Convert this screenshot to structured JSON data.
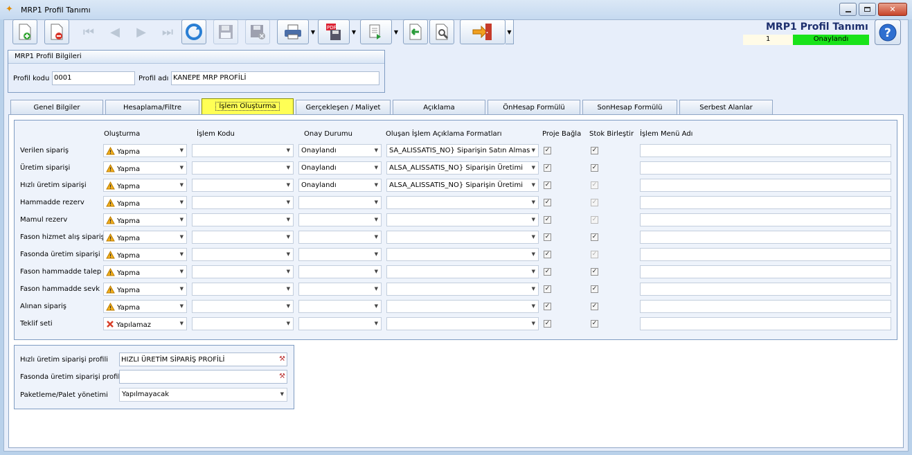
{
  "window": {
    "title": "MRP1 Profil Tanımı"
  },
  "header": {
    "title": "MRP1 Profil Tanımı",
    "record_no": "1",
    "status": "Onaylandı",
    "status_color": "#19e319"
  },
  "toolbar": {
    "icons": [
      "new-doc-icon",
      "delete-doc-icon",
      "first-record-icon",
      "prev-record-icon",
      "next-record-icon",
      "last-record-icon",
      "refresh-icon",
      "save-icon",
      "save-close-icon",
      "print-icon",
      "pdf-export-icon",
      "export-icon",
      "import-icon",
      "settings-icon",
      "exit-icon"
    ]
  },
  "profile_info": {
    "header": "MRP1 Profil Bilgileri",
    "code_label": "Profil kodu",
    "code_value": "0001",
    "name_label": "Profil adı",
    "name_value": "KANEPE MRP PROFİLİ"
  },
  "tabs": [
    "Genel Bilgiler",
    "Hesaplama/Filtre",
    "İşlem Oluşturma",
    "Gerçekleşen / Maliyet",
    "Açıklama",
    "ÖnHesap Formülü",
    "SonHesap Formülü",
    "Serbest Alanlar"
  ],
  "active_tab": "İşlem Oluşturma",
  "grid": {
    "columns": {
      "olusturma": "Oluşturma",
      "islem_kodu": "İşlem Kodu",
      "onay": "Onay Durumu",
      "aciklama": "Oluşan İşlem Açıklama Formatları",
      "proje": "Proje Bağla",
      "stok": "Stok Birleştir",
      "menu": "İşlem Menü Adı"
    },
    "rows": [
      {
        "label": "Verilen sipariş",
        "olusturma": "Yapma",
        "icon": "warning-icon",
        "onay": "Onaylandı",
        "aciklama": "SA_ALISSATIS_NO} Siparişin Satın Alması",
        "proje": true,
        "stok": true,
        "stok_enabled": true
      },
      {
        "label": "Üretim siparişi",
        "olusturma": "Yapma",
        "icon": "warning-icon",
        "onay": "Onaylandı",
        "aciklama": "ALSA_ALISSATIS_NO} Siparişin Üretimi",
        "proje": true,
        "stok": true,
        "stok_enabled": true
      },
      {
        "label": "Hızlı üretim siparişi",
        "olusturma": "Yapma",
        "icon": "warning-icon",
        "onay": "Onaylandı",
        "aciklama": "ALSA_ALISSATIS_NO} Siparişin Üretimi",
        "proje": true,
        "stok": true,
        "stok_enabled": false
      },
      {
        "label": "Hammadde rezerv",
        "olusturma": "Yapma",
        "icon": "warning-icon",
        "onay": "",
        "aciklama": "",
        "proje": true,
        "stok": true,
        "stok_enabled": false
      },
      {
        "label": "Mamul rezerv",
        "olusturma": "Yapma",
        "icon": "warning-icon",
        "onay": "",
        "aciklama": "",
        "proje": true,
        "stok": true,
        "stok_enabled": false
      },
      {
        "label": "Fason hizmet alış siparişi",
        "olusturma": "Yapma",
        "icon": "warning-icon",
        "onay": "",
        "aciklama": "",
        "proje": true,
        "stok": true,
        "stok_enabled": true
      },
      {
        "label": "Fasonda üretim siparişi",
        "olusturma": "Yapma",
        "icon": "warning-icon",
        "onay": "",
        "aciklama": "",
        "proje": true,
        "stok": true,
        "stok_enabled": false
      },
      {
        "label": "Fason hammadde talep",
        "olusturma": "Yapma",
        "icon": "warning-icon",
        "onay": "",
        "aciklama": "",
        "proje": true,
        "stok": true,
        "stok_enabled": true
      },
      {
        "label": "Fason hammadde sevk",
        "olusturma": "Yapma",
        "icon": "warning-icon",
        "onay": "",
        "aciklama": "",
        "proje": true,
        "stok": true,
        "stok_enabled": true
      },
      {
        "label": "Alınan sipariş",
        "olusturma": "Yapma",
        "icon": "warning-icon",
        "onay": "",
        "aciklama": "",
        "proje": true,
        "stok": true,
        "stok_enabled": true
      },
      {
        "label": "Teklif seti",
        "olusturma": "Yapılamaz",
        "icon": "cross-icon",
        "onay": "",
        "aciklama": "",
        "proje": true,
        "stok": true,
        "stok_enabled": true
      }
    ]
  },
  "bottom": {
    "fast_label": "Hızlı üretim siparişi profili",
    "fast_value": "HIZLI ÜRETİM SİPARİŞ PROFİLİ",
    "fason_label": "Fasonda üretim siparişi profili",
    "fason_value": "",
    "pallet_label": "Paketleme/Palet yönetimi",
    "pallet_value": "Yapılmayacak"
  }
}
